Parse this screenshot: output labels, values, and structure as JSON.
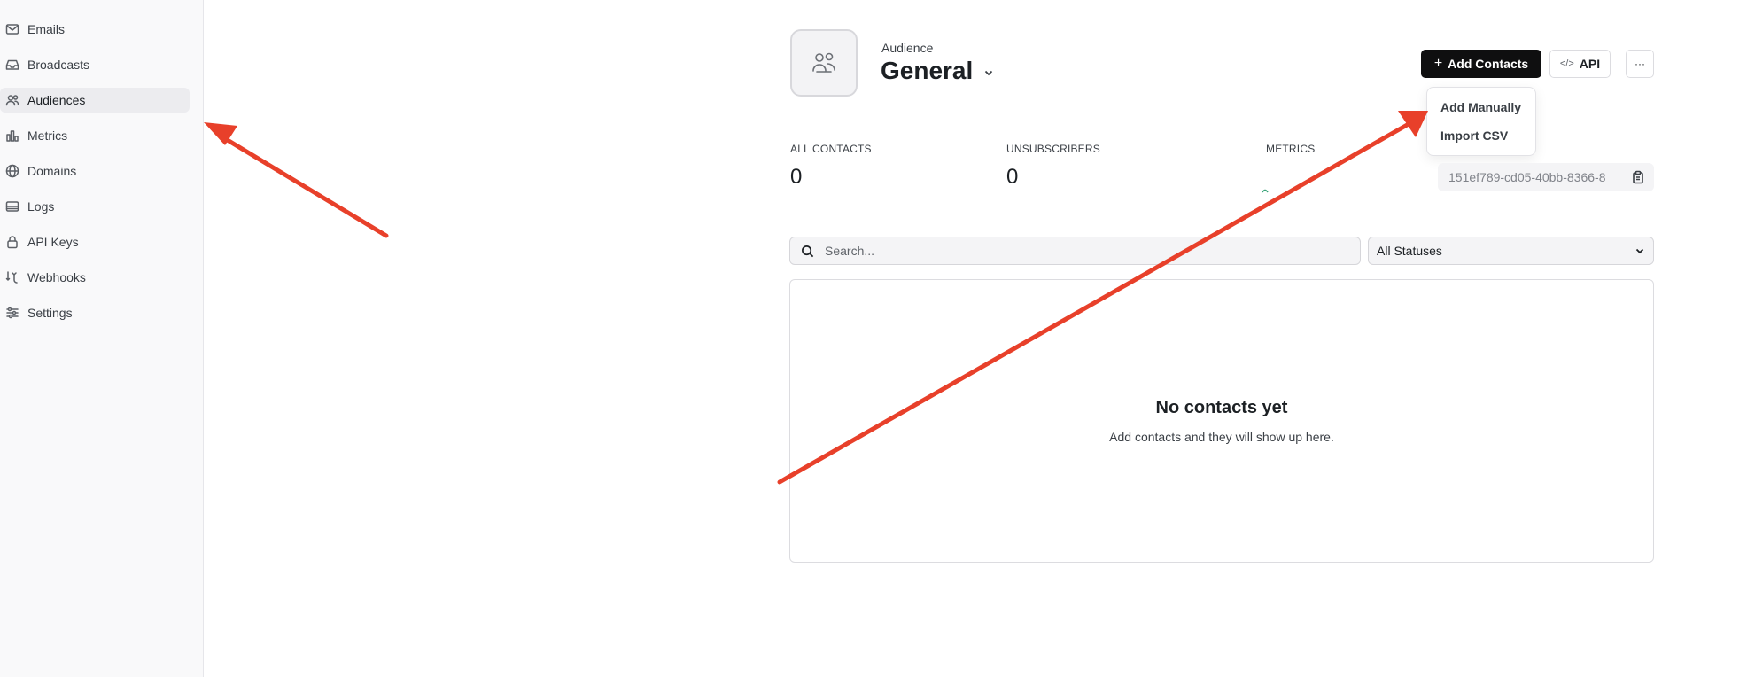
{
  "sidebar": {
    "items": [
      {
        "label": "Emails",
        "icon": "mail-icon"
      },
      {
        "label": "Broadcasts",
        "icon": "inbox-icon"
      },
      {
        "label": "Audiences",
        "icon": "users-icon",
        "active": true
      },
      {
        "label": "Metrics",
        "icon": "bar-chart-icon"
      },
      {
        "label": "Domains",
        "icon": "globe-icon"
      },
      {
        "label": "Logs",
        "icon": "list-icon"
      },
      {
        "label": "API Keys",
        "icon": "lock-icon"
      },
      {
        "label": "Webhooks",
        "icon": "webhook-icon"
      },
      {
        "label": "Settings",
        "icon": "sliders-icon"
      }
    ]
  },
  "header": {
    "eyebrow": "Audience",
    "title": "General",
    "add_contacts_label": "Add Contacts",
    "api_label": "API",
    "more_label": "···"
  },
  "dropdown": {
    "items": [
      "Add Manually",
      "Import CSV"
    ]
  },
  "stats": {
    "all_contacts_label": "ALL CONTACTS",
    "all_contacts_value": "0",
    "unsubscribers_label": "UNSUBSCRIBERS",
    "unsubscribers_value": "0",
    "metrics_label": "METRICS"
  },
  "audience_id": "151ef789-cd05-40bb-8366-8",
  "filters": {
    "search_placeholder": "Search...",
    "status_value": "All Statuses"
  },
  "empty_state": {
    "title": "No contacts yet",
    "subtitle": "Add contacts and they will show up here."
  },
  "colors": {
    "primary_button": "#0f0f10",
    "annotation_arrow": "#e8402a",
    "active_nav": "#ececef"
  }
}
